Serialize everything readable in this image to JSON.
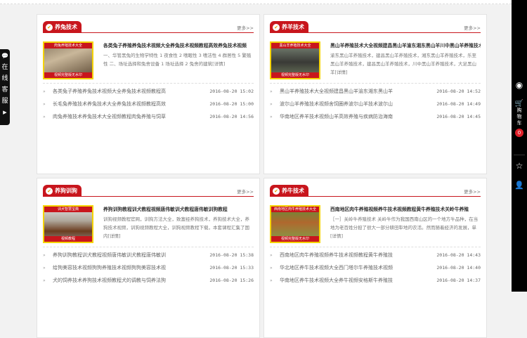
{
  "more_label": "更多>>",
  "left_float": {
    "chars": [
      "在",
      "线",
      "客",
      "服"
    ],
    "arrow": "▶"
  },
  "right_bar": {
    "cart_label": [
      "购",
      "物",
      "车"
    ],
    "cart_count": "0"
  },
  "panels": [
    {
      "title": "养兔技术",
      "thumb_top": "肉兔养殖技术大全",
      "thumb_bottom": "视频完整版无水印",
      "feature_title": "各类兔子养殖养兔技术视频大全养兔技术视频教程高效养兔技术视频",
      "feature_desc": "一、华管黑兔的生物学特性 1 夜食性 2 嗜眠性 3 嗜洁性 4 群居性 5 繁殖性 二、场址选择和兔舍设备 1 场址选择 2 兔舍的建筑",
      "detail": "[详情]",
      "items": [
        {
          "t": "各类兔子养殖养兔技术视频大全养兔技术视频教程高",
          "d": "2016-08-20 15:02"
        },
        {
          "t": "长毛兔养殖技术养兔技术大全养兔技术视频教程高效",
          "d": "2016-08-20 15:00"
        },
        {
          "t": "肉兔养殖技术养兔技术大全视频教程肉兔养殖与饲草",
          "d": "2016-08-20 14:56"
        }
      ]
    },
    {
      "title": "养羊技术",
      "thumb_top": "黑山羊养殖技术大全",
      "thumb_bottom": "视频完整版无水印",
      "feature_title": "黑山羊养殖技术大全视频建昌黑山羊渝东湘东黑山羊川中黑山羊养殖技术视频",
      "feature_desc": "渝东黑山羊养殖技术，建昌黑山羊养殖技术，湘东黑山羊养殖技术，乐至黑山羊养殖技术，建昌黑山羊养殖技术，川中黑山羊养殖技术，大足黑山羊",
      "detail": "[详情]",
      "items": [
        {
          "t": "黑山羊养殖技术大全视频建昌黑山羊渝东湘东黑山羊",
          "d": "2016-08-20 14:52"
        },
        {
          "t": "波尔山羊养殖技术视频舍饲圈养波尔山羊技术波尔山",
          "d": "2016-08-20 14:49"
        },
        {
          "t": "华南地区养羊技术视频山羊高效养殖与疾病防治海南",
          "d": "2016-08-20 14:45"
        }
      ]
    },
    {
      "title": "养狗训狗",
      "thumb_top": "训犬智慧宝典",
      "thumb_bottom": "视频教程",
      "feature_title": "养狗训狗教程训犬教程视频唐伟敏训犬教程唐伟敏训狗教程",
      "feature_desc": "训狗视频教程官网，训狗方法大全，致富经养狗技术，养狗技术大全，养狗技术视频，训狗视频教程大全，训狗视频教程下载，本套课程汇集了国内",
      "detail": "[详情]",
      "items": [
        {
          "t": "养狗训狗教程训犬教程视频唐伟敏训犬教程唐伟敏训",
          "d": "2016-08-20 15:38"
        },
        {
          "t": "给狗美容技术视频狗狗养殖技术视频狗狗美容技术视",
          "d": "2016-08-20 15:33"
        },
        {
          "t": "犬的饲养技术养狗技术视频教程犬的调教与饲养法狗",
          "d": "2016-08-20 15:26"
        }
      ]
    },
    {
      "title": "养牛技术",
      "thumb_top": "西南地区肉牛养殖技术大全",
      "thumb_bottom": "视频完整版无水印",
      "feature_title": "西南地区肉牛养殖视频养牛技术视频教程黄牛养殖技术关岭牛养殖",
      "feature_desc": "［一］关岭牛养殖技术 关岭牛作为我国西南山区的一个地方牛品种，在当地为老百姓分担了很大一部分耕田犁地的农活。然而随着经济的发展，单",
      "detail": "[详情]",
      "items": [
        {
          "t": "西南地区肉牛养殖视频养牛技术视频教程黄牛养殖技",
          "d": "2016-08-20 14:43"
        },
        {
          "t": "华北地区养牛技术视频大全西门塔尔牛养殖技术视频",
          "d": "2016-08-20 14:40"
        },
        {
          "t": "华南地区养牛技术视频大全养牛视频安格斯牛养殖技",
          "d": "2016-08-20 14:37"
        }
      ]
    }
  ]
}
